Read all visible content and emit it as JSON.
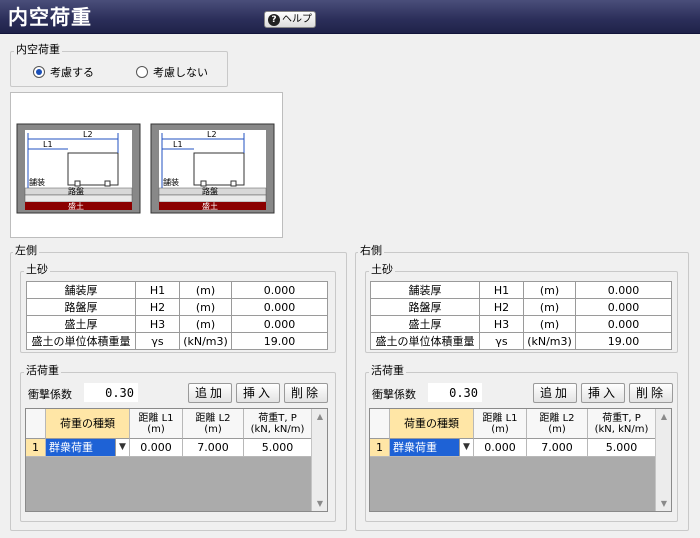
{
  "header": {
    "title": "内空荷重",
    "help_label": "ヘルプ",
    "help_icon": "question-circle-icon"
  },
  "internal_load": {
    "group_label": "内空荷重",
    "options": [
      {
        "label": "考慮する",
        "selected": true
      },
      {
        "label": "考慮しない",
        "selected": false
      }
    ]
  },
  "diagram": {
    "labels": {
      "l1": "L1",
      "l2": "L2",
      "pavement": "舗装",
      "roadbed": "路盤",
      "embankment": "盛土"
    }
  },
  "left": {
    "side_label": "左側",
    "soil": {
      "group_label": "土砂",
      "rows": [
        {
          "name": "舗装厚",
          "symbol": "H1",
          "unit": "(m)",
          "value": "0.000"
        },
        {
          "name": "路盤厚",
          "symbol": "H2",
          "unit": "(m)",
          "value": "0.000"
        },
        {
          "name": "盛土厚",
          "symbol": "H3",
          "unit": "(m)",
          "value": "0.000"
        },
        {
          "name": "盛土の単位体積重量",
          "symbol": "γs",
          "unit": "(kN/m3)",
          "value": "19.00"
        }
      ]
    },
    "live_load": {
      "group_label": "活荷重",
      "impact_label": "衝撃係数",
      "impact_value": "0.30",
      "buttons": {
        "add": "追加",
        "insert": "挿入",
        "delete": "削除"
      },
      "columns": {
        "type": "荷重の種類",
        "l1": "距離 L1",
        "l1_unit": "(m)",
        "l2": "距離 L2",
        "l2_unit": "(m)",
        "p": "荷重T, P",
        "p_unit": "(kN, kN/m)"
      },
      "rows": [
        {
          "num": "1",
          "type": "群衆荷重",
          "l1": "0.000",
          "l2": "7.000",
          "p": "5.000"
        }
      ]
    }
  },
  "right": {
    "side_label": "右側",
    "soil": {
      "group_label": "土砂",
      "rows": [
        {
          "name": "舗装厚",
          "symbol": "H1",
          "unit": "(m)",
          "value": "0.000"
        },
        {
          "name": "路盤厚",
          "symbol": "H2",
          "unit": "(m)",
          "value": "0.000"
        },
        {
          "name": "盛土厚",
          "symbol": "H3",
          "unit": "(m)",
          "value": "0.000"
        },
        {
          "name": "盛土の単位体積重量",
          "symbol": "γs",
          "unit": "(kN/m3)",
          "value": "19.00"
        }
      ]
    },
    "live_load": {
      "group_label": "活荷重",
      "impact_label": "衝撃係数",
      "impact_value": "0.30",
      "buttons": {
        "add": "追加",
        "insert": "挿入",
        "delete": "削除"
      },
      "columns": {
        "type": "荷重の種類",
        "l1": "距離 L1",
        "l1_unit": "(m)",
        "l2": "距離 L2",
        "l2_unit": "(m)",
        "p": "荷重T, P",
        "p_unit": "(kN, kN/m)"
      },
      "rows": [
        {
          "num": "1",
          "type": "群衆荷重",
          "l1": "0.000",
          "l2": "7.000",
          "p": "5.000"
        }
      ]
    }
  },
  "colors": {
    "titlebar": "#2b2e59",
    "selection": "#1e62d6",
    "header_highlight": "#ffe6a6",
    "embankment": "#8b0000"
  }
}
